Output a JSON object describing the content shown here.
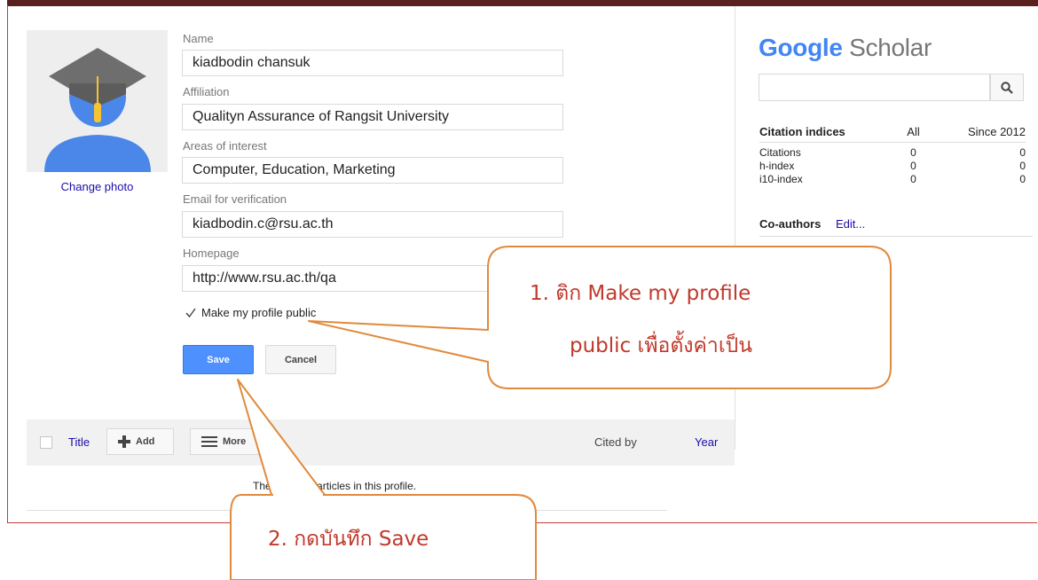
{
  "profile": {
    "change_photo": "Change photo",
    "fields": {
      "name": {
        "label": "Name",
        "value": "kiadbodin chansuk"
      },
      "affiliation": {
        "label": "Affiliation",
        "value": "Qualityn Assurance of Rangsit University"
      },
      "interests": {
        "label": "Areas of interest",
        "value": "Computer, Education, Marketing"
      },
      "email": {
        "label": "Email for verification",
        "value": "kiadbodin.c@rsu.ac.th"
      },
      "homepage": {
        "label": "Homepage",
        "value": "http://www.rsu.ac.th/qa"
      }
    },
    "public_checkbox_label": "Make my profile public",
    "public_checked": true,
    "save_label": "Save",
    "cancel_label": "Cancel"
  },
  "articles": {
    "title_col": "Title",
    "add_label": "Add",
    "more_label": "More",
    "cited_by_col": "Cited by",
    "year_col": "Year",
    "empty_message": "There are no articles in this profile."
  },
  "sidebar": {
    "logo_brand": "Google",
    "logo_product": "Scholar",
    "citations": {
      "header": [
        "Citation indices",
        "All",
        "Since 2012"
      ],
      "rows": [
        [
          "Citations",
          "0",
          "0"
        ],
        [
          "h-index",
          "0",
          "0"
        ],
        [
          "i10-index",
          "0",
          "0"
        ]
      ]
    },
    "coauthors_label": "Co-authors",
    "coauthors_edit": "Edit..."
  },
  "annotations": {
    "callout1_line1": "1.   ติก Make my profile",
    "callout1_line2": "public เพื่อตั้งค่าเป็น",
    "callout2": "2. กดบันทึก Save"
  },
  "colors": {
    "accent_blue": "#4d90fe",
    "link": "#1a0dab",
    "callout_border": "#e08a3c",
    "callout_text": "#c0392b"
  }
}
